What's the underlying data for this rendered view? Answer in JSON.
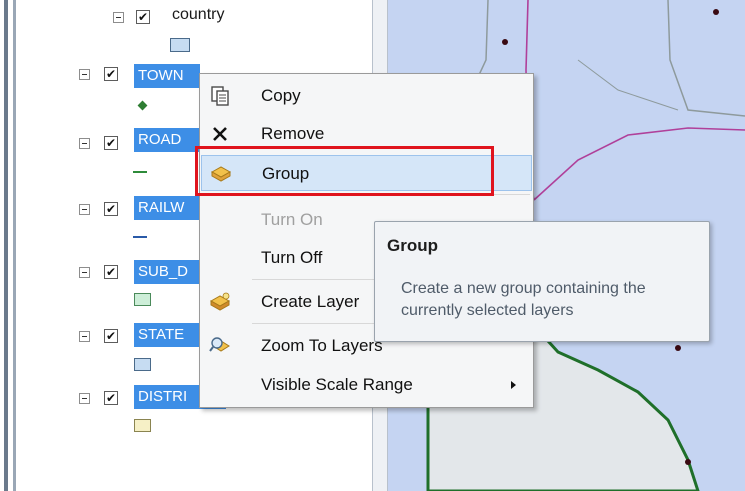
{
  "toc": {
    "layers": [
      {
        "name": "country",
        "swatch_color": "#c6dcf2",
        "swatch_border": "#4a6a8a"
      },
      {
        "name": "TOWN",
        "symbol_color": "#2e7d32"
      },
      {
        "name": "ROAD",
        "symbol_color": "#2e8b3a"
      },
      {
        "name": "RAILW",
        "symbol_color": "#2a5aa8"
      },
      {
        "name": "SUB_D",
        "swatch_color": "#cdeed8",
        "swatch_border": "#4a8a5a"
      },
      {
        "name": "STATE",
        "swatch_color": "#c6dcf2",
        "swatch_border": "#4a6a8a"
      },
      {
        "name": "DISTRI",
        "swatch_color": "#f6f0c6",
        "swatch_border": "#8a8450"
      }
    ],
    "check_glyph": "✔"
  },
  "context_menu": {
    "items": [
      {
        "label": "Copy",
        "icon": "copy-icon",
        "enabled": true
      },
      {
        "label": "Remove",
        "icon": "remove-icon",
        "enabled": true
      },
      {
        "label": "Group",
        "icon": "group-icon",
        "enabled": true,
        "hovered": true
      },
      {
        "label": "Turn On",
        "icon": "",
        "enabled": false
      },
      {
        "label": "Turn Off",
        "icon": "",
        "enabled": true
      },
      {
        "label": "Create Layer",
        "icon": "create-layer-icon",
        "enabled": true
      },
      {
        "label": "Zoom To Layers",
        "icon": "zoom-to-layers-icon",
        "enabled": true
      },
      {
        "label": "Visible Scale Range",
        "icon": "",
        "enabled": true,
        "has_submenu": true
      }
    ]
  },
  "tooltip": {
    "title": "Group",
    "body": "Create a new group containing the currently selected layers"
  },
  "colors": {
    "selection": "#3d8ee6",
    "map_water": "#c5d4f2",
    "highlight_frame": "#e0141e"
  }
}
